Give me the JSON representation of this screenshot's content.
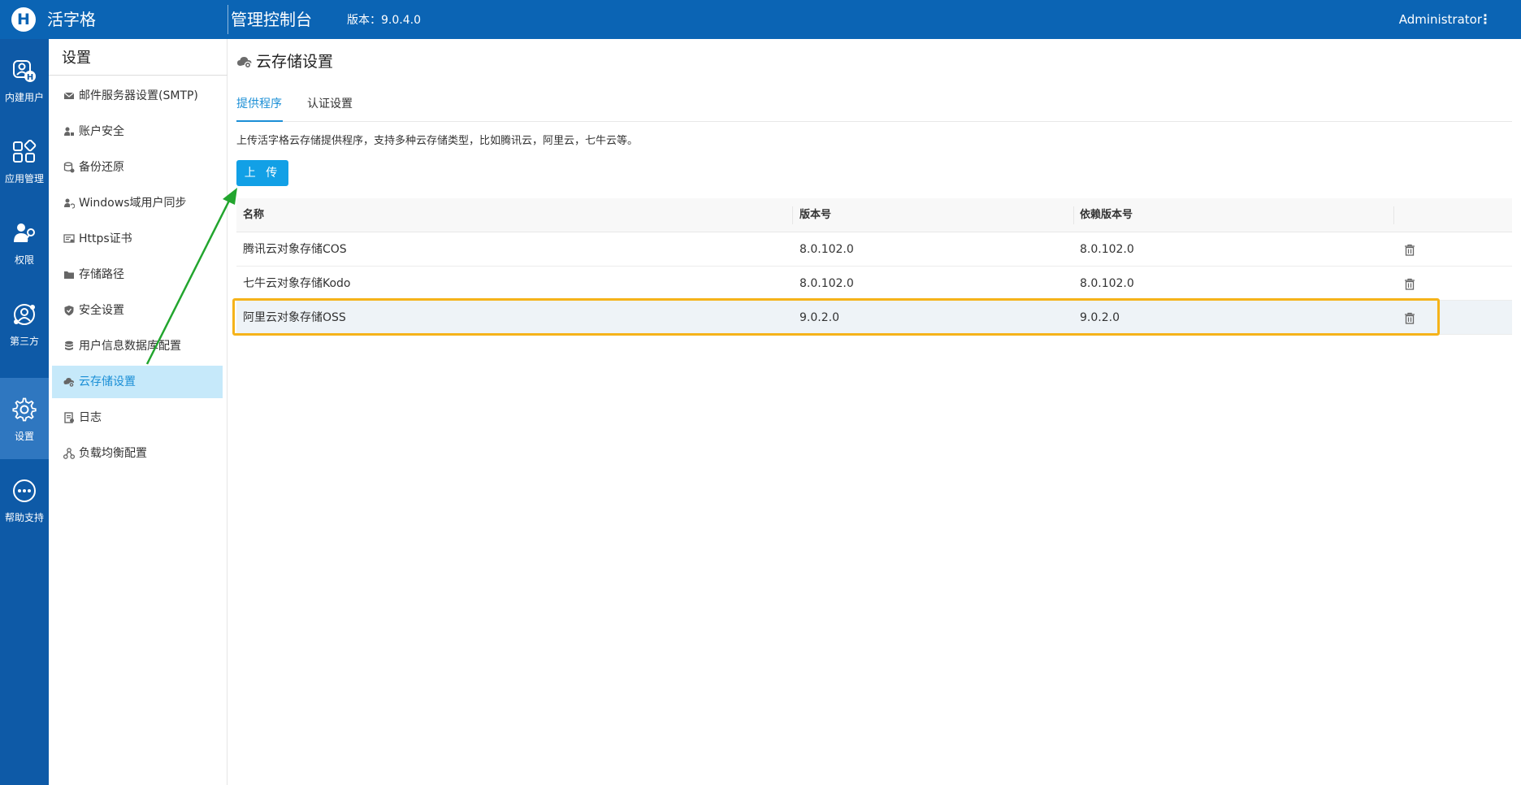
{
  "header": {
    "logo_letter": "H",
    "app_name": "活字格",
    "console_title": "管理控制台",
    "version_label": "版本：",
    "version_value": "9.0.4.0",
    "user_name": "Administrator",
    "more_icon": "⋮"
  },
  "rail": {
    "items": [
      {
        "label": "内建用户",
        "icon": "user-badge-icon"
      },
      {
        "label": "应用管理",
        "icon": "apps-grid-icon"
      },
      {
        "label": "权限",
        "icon": "user-key-icon"
      },
      {
        "label": "第三方",
        "icon": "third-party-icon"
      },
      {
        "label": "设置",
        "icon": "gear-icon",
        "active": true
      },
      {
        "label": "帮助支持",
        "icon": "more-circle-icon"
      }
    ]
  },
  "submenu": {
    "title": "设置",
    "items": [
      {
        "label": "邮件服务器设置(SMTP)",
        "icon": "mail-icon"
      },
      {
        "label": "账户安全",
        "icon": "user-lock-icon"
      },
      {
        "label": "备份还原",
        "icon": "backup-icon"
      },
      {
        "label": "Windows域用户同步",
        "icon": "sync-user-icon"
      },
      {
        "label": "Https证书",
        "icon": "certificate-icon"
      },
      {
        "label": "存储路径",
        "icon": "folder-icon"
      },
      {
        "label": "安全设置",
        "icon": "shield-icon"
      },
      {
        "label": "用户信息数据库配置",
        "icon": "database-icon"
      },
      {
        "label": "云存储设置",
        "icon": "cloud-gear-icon",
        "active": true
      },
      {
        "label": "日志",
        "icon": "log-icon"
      },
      {
        "label": "负载均衡配置",
        "icon": "load-balance-icon"
      }
    ]
  },
  "main": {
    "title": "云存储设置",
    "tabs": [
      {
        "label": "提供程序",
        "active": true
      },
      {
        "label": "认证设置",
        "active": false
      }
    ],
    "description": "上传活字格云存储提供程序，支持多种云存储类型，比如腾讯云，阿里云，七牛云等。",
    "upload_label": "上 传",
    "table": {
      "columns": [
        "名称",
        "版本号",
        "依赖版本号",
        ""
      ],
      "rows": [
        {
          "name": "腾讯云对象存储COS",
          "version": "8.0.102.0",
          "dep_version": "8.0.102.0"
        },
        {
          "name": "七牛云对象存储Kodo",
          "version": "8.0.102.0",
          "dep_version": "8.0.102.0"
        },
        {
          "name": "阿里云对象存储OSS",
          "version": "9.0.2.0",
          "dep_version": "9.0.2.0",
          "selected": true
        }
      ]
    }
  },
  "colors": {
    "topbar": "#0b64b4",
    "rail": "#0e5aa7",
    "accent": "#1b8fd6",
    "button": "#12a0e6",
    "highlight": "#f5b31a",
    "arrow": "#22a52e"
  }
}
